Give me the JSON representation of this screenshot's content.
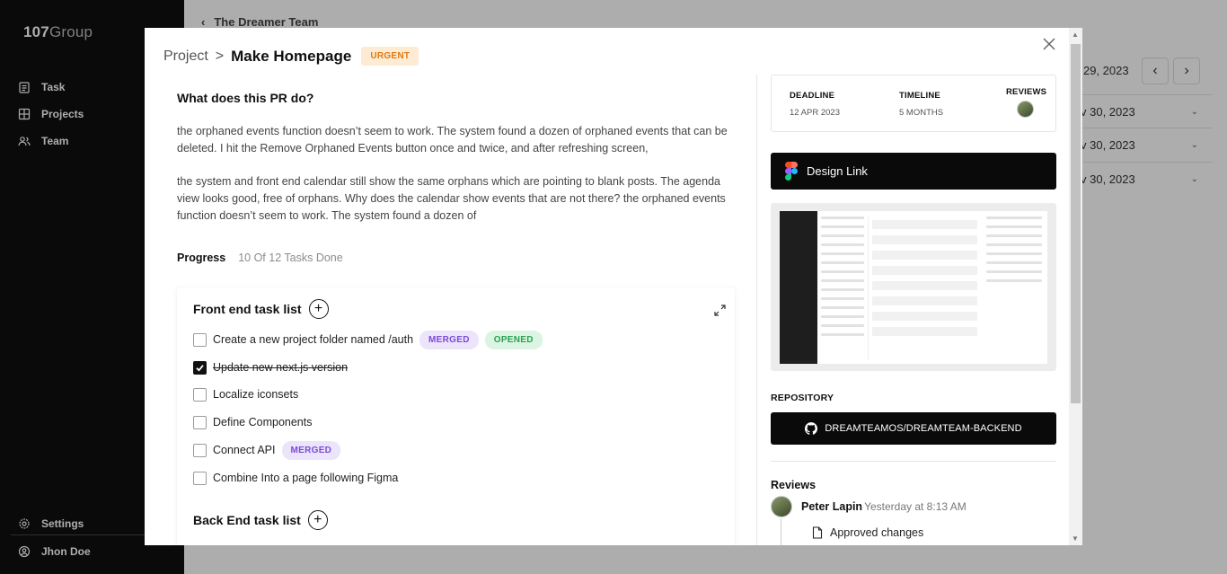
{
  "app": {
    "logo_bold": "107",
    "logo_light": "Group",
    "nav": [
      {
        "label": "Task",
        "icon": "clipboard-icon"
      },
      {
        "label": "Projects",
        "icon": "grid-icon"
      },
      {
        "label": "Team",
        "icon": "team-icon"
      }
    ],
    "settings_label": "Settings",
    "user_name": "Jhon Doe",
    "back_label": "The Dreamer Team",
    "bg_top_date": "29, 2023",
    "bg_rows": [
      "v 30, 2023",
      "v 30, 2023",
      "v 30, 2023"
    ]
  },
  "modal": {
    "crumb_project": "Project",
    "crumb_sep": ">",
    "title": "Make Homepage",
    "badge": "URGENT",
    "pr_title": "What does this PR do?",
    "pr_paragraphs": [
      "the orphaned events function doesn’t seem to work. The system found a dozen of orphaned events that can be deleted. I hit the Remove Orphaned Events button once and twice, and after refreshing screen,",
      "the system and front end calendar still show the same orphans which are pointing to blank posts. The agenda view looks good, free of orphans. Why does the calendar show events that are not there? the orphaned events function doesn’t seem to work. The system found a dozen of"
    ],
    "progress_label": "Progress",
    "progress_value": "10 Of 12 Tasks Done",
    "front_end_title": "Front end task list",
    "front_end_tasks": [
      {
        "label": "Create a new project folder named /auth",
        "done": false,
        "tags": [
          "MERGED",
          "OPENED"
        ]
      },
      {
        "label": "Update new next.js version",
        "done": true,
        "tags": []
      },
      {
        "label": "Localize iconsets",
        "done": false,
        "tags": []
      },
      {
        "label": "Define Components",
        "done": false,
        "tags": []
      },
      {
        "label": "Connect API",
        "done": false,
        "tags": [
          "MERGED"
        ]
      },
      {
        "label": "Combine Into a page following Figma",
        "done": false,
        "tags": []
      }
    ],
    "back_end_title": "Back End task list",
    "meta": {
      "deadline_label": "DEADLINE",
      "deadline_value": "12 APR 2023",
      "timeline_label": "TIMELINE",
      "timeline_value": "5 MONTHS",
      "reviews_label": "REVIEWS"
    },
    "design_link_label": "Design Link",
    "repository_label": "REPOSITORY",
    "repository_name": "DREAMTEAMOS/DREAMTEAM-BACKEND",
    "reviews_title": "Reviews",
    "review": {
      "name": "Peter Lapin",
      "time": "Yesterday at 8:13 AM",
      "note": "Approved changes"
    }
  },
  "colors": {
    "urgent_bg": "#fdebd3",
    "urgent_fg": "#e07a12",
    "merged_bg": "#ece4fb",
    "merged_fg": "#7c4ad6",
    "opened_bg": "#dcf5e3",
    "opened_fg": "#2aa050"
  }
}
